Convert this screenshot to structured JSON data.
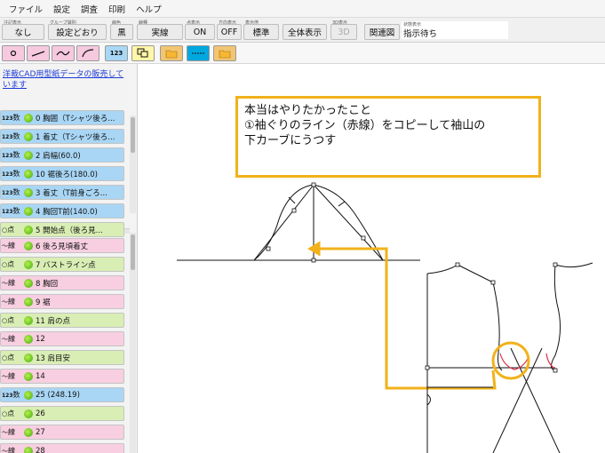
{
  "menu": {
    "file": "ファイル",
    "settings": "設定",
    "survey": "調査",
    "print": "印刷",
    "help": "ヘルプ"
  },
  "props": [
    {
      "caption": "注記表示",
      "value": "なし"
    },
    {
      "caption": "グループ識別",
      "value": "設定どおり"
    },
    {
      "caption": "線色",
      "value": "黒"
    },
    {
      "caption": "線種",
      "value": "実線"
    },
    {
      "caption": "点表示",
      "value": "ON"
    },
    {
      "caption": "方向表示",
      "value": "OFF"
    },
    {
      "caption": "表示倍",
      "value": "標準"
    },
    {
      "caption": "",
      "value": "全体表示"
    },
    {
      "caption": "3D表示",
      "value": "3D"
    },
    {
      "caption": "",
      "value": "関連図"
    }
  ],
  "status": {
    "caption": "状態表示",
    "value": "指示待ち"
  },
  "tools": {
    "number_label": "123"
  },
  "promo": "洋裁CAD用型紙データの販売しています",
  "kinds": {
    "num": "数",
    "pt": "点",
    "line": "線",
    "num_prefix": "123"
  },
  "items": [
    {
      "kind": "num",
      "label": "0 胸囲（Tシャツ後ろ..."
    },
    {
      "kind": "num",
      "label": "1 着丈（Tシャツ後ろ..."
    },
    {
      "kind": "num",
      "label": "2 肩幅(60.0)"
    },
    {
      "kind": "num",
      "label": "10 裾後ろ(180.0)"
    },
    {
      "kind": "num",
      "label": "3 着丈（T前身ごろ..."
    },
    {
      "kind": "num",
      "label": "4 胸回T前(140.0)"
    },
    {
      "kind": "pt",
      "label": "5 開始点（後ろ見..."
    },
    {
      "kind": "line",
      "label": "6 後ろ見頃着丈"
    },
    {
      "kind": "pt",
      "label": "7 バストライン点"
    },
    {
      "kind": "line",
      "label": "8 胸回"
    },
    {
      "kind": "line",
      "label": "9 裾"
    },
    {
      "kind": "pt",
      "label": "11 肩の点"
    },
    {
      "kind": "line",
      "label": "12"
    },
    {
      "kind": "pt",
      "label": "13 肩目安"
    },
    {
      "kind": "line",
      "label": "14"
    },
    {
      "kind": "num",
      "label": "25 (248.19)"
    },
    {
      "kind": "pt",
      "label": "26"
    },
    {
      "kind": "line",
      "label": "27"
    },
    {
      "kind": "line",
      "label": "28"
    }
  ],
  "annotation": {
    "line1": "本当はやりたかったこと",
    "line2": "①袖ぐりのライン（赤線）をコピーして袖山の",
    "line3": "下カーブにうつす"
  },
  "colors": {
    "highlight": "#f1b21a",
    "sleeve_curve": "#e0304a",
    "num_item": "#a9d6f5",
    "point_item": "#d9eeb4",
    "line_item": "#f8cfe0"
  }
}
